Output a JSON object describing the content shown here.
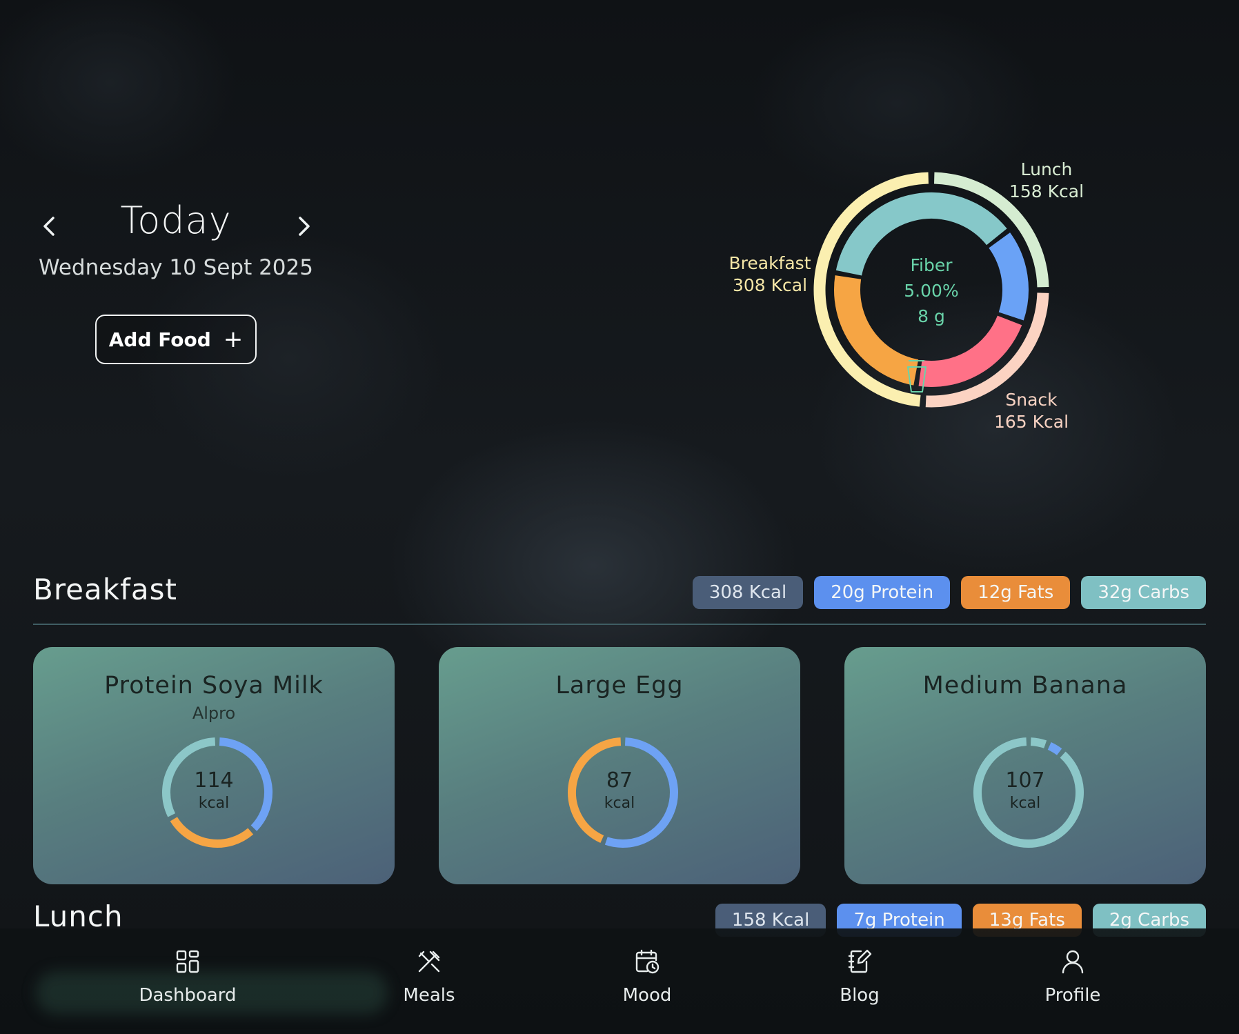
{
  "header": {
    "title": "Today",
    "date": "Wednesday 10 Sept 2025",
    "add_food_label": "Add Food"
  },
  "summary_chart": {
    "center": {
      "label": "Fiber",
      "percent": "5.00%",
      "grams": "8 g"
    },
    "meals": [
      {
        "name": "Breakfast",
        "kcal_label": "308 Kcal",
        "kcal": 308,
        "color": "#fbefb0"
      },
      {
        "name": "Lunch",
        "kcal_label": "158 Kcal",
        "kcal": 158,
        "color": "#d5ecd1"
      },
      {
        "name": "Snack",
        "kcal_label": "165 Kcal",
        "kcal": 165,
        "color": "#fbd3c2"
      }
    ],
    "macros": [
      {
        "name": "Carbs",
        "color": "#86c8c9",
        "share": 0.335
      },
      {
        "name": "Protein",
        "color": "#6aa2f6",
        "share": 0.145
      },
      {
        "name": "Fiber",
        "color": "#ff7187",
        "share": 0.2
      },
      {
        "name": "Fats",
        "color": "#f6a544",
        "share": 0.23
      }
    ]
  },
  "breakfast": {
    "title": "Breakfast",
    "pills": {
      "kcal": "308 Kcal",
      "protein": "20g Protein",
      "fats": "12g Fats",
      "carbs": "32g Carbs"
    },
    "foods": [
      {
        "name": "Protein Soya Milk",
        "brand": "Alpro",
        "kcal": "114",
        "unit": "kcal",
        "segments": [
          {
            "color": "#6ea2f4",
            "share": 0.38
          },
          {
            "color": "#f6a544",
            "share": 0.29
          },
          {
            "color": "#8cc7c8",
            "share": 0.33
          }
        ]
      },
      {
        "name": "Large Egg",
        "brand": "",
        "kcal": "87",
        "unit": "kcal",
        "segments": [
          {
            "color": "#6ea2f4",
            "share": 0.56
          },
          {
            "color": "#f6a544",
            "share": 0.44
          }
        ]
      },
      {
        "name": "Medium Banana",
        "brand": "",
        "kcal": "107",
        "unit": "kcal",
        "segments": [
          {
            "color": "#8cc7c8",
            "share": 0.06
          },
          {
            "color": "#6ea2f4",
            "share": 0.05
          },
          {
            "color": "#8cc7c8",
            "share": 0.89
          }
        ]
      }
    ]
  },
  "lunch": {
    "title": "Lunch",
    "pills": {
      "kcal": "158 Kcal",
      "protein": "7g Protein",
      "fats": "13g Fats",
      "carbs": "2g Carbs"
    }
  },
  "nav": {
    "items": [
      {
        "label": "Dashboard",
        "icon": "grid-icon"
      },
      {
        "label": "Meals",
        "icon": "utensils-icon"
      },
      {
        "label": "Mood",
        "icon": "calendar-clock-icon"
      },
      {
        "label": "Blog",
        "icon": "notebook-edit-icon"
      },
      {
        "label": "Profile",
        "icon": "user-icon"
      }
    ]
  }
}
